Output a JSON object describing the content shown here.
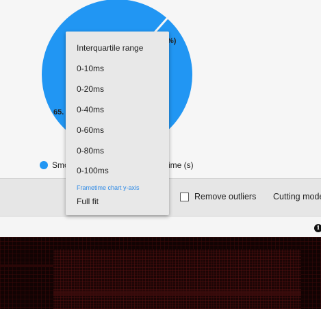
{
  "chart": {
    "slice_label_a": "65.",
    "slice_label_b": "%)",
    "legend_a": "Smo",
    "legend_b": "ime (s)",
    "color": "#2196f3"
  },
  "toolbar": {
    "remove_outliers_label": "Remove outliers",
    "remove_outliers_checked": false,
    "cutting_mode_label": "Cutting mode"
  },
  "dropdown": {
    "items": [
      "Interquartile range",
      "0-10ms",
      "0-20ms",
      "0-40ms",
      "0-60ms",
      "0-80ms",
      "0-100ms"
    ],
    "caption": "Frametime chart y-axis",
    "selected": "Full fit"
  },
  "icons": {
    "info": "info-icon"
  }
}
